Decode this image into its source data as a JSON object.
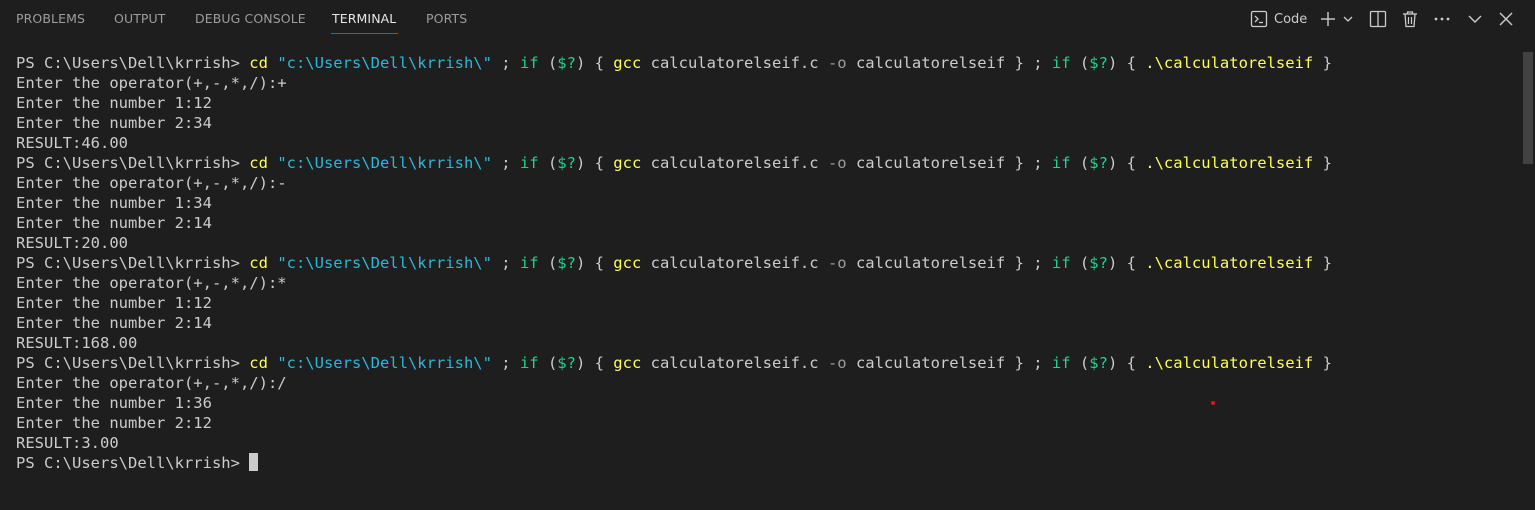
{
  "tabs": [
    {
      "label": "PROBLEMS",
      "active": false
    },
    {
      "label": "OUTPUT",
      "active": false
    },
    {
      "label": "DEBUG CONSOLE",
      "active": false
    },
    {
      "label": "TERMINAL",
      "active": true
    },
    {
      "label": "PORTS",
      "active": false
    }
  ],
  "toolbar": {
    "terminal_profile_label": "Code",
    "icons": [
      "terminal-icon",
      "plus-icon",
      "chevron-down-icon",
      "split-icon",
      "trash-icon",
      "more-icon",
      "chevron-down-icon",
      "close-icon"
    ]
  },
  "terminal": {
    "prompt": "PS C:\\Users\\Dell\\krrish> ",
    "command": {
      "cd": "cd",
      "path": "\"c:\\Users\\Dell\\krrish\\\"",
      "sep1": " ; ",
      "if1": "if",
      "cond1_open": " (",
      "cond1_var": "$?",
      "cond1_close": ") { ",
      "gcc": "gcc",
      "src": " calculatorelseif.c ",
      "flag": "-o",
      "out": " calculatorelseif } ; ",
      "if2": "if",
      "cond2_open": " (",
      "cond2_var": "$?",
      "cond2_close": ") { ",
      "exe": ".\\calculatorelseif",
      "end": " }"
    },
    "runs": [
      {
        "operator_line": "Enter the operator(+,-,*,/):+",
        "num1_line": "Enter the number 1:12",
        "num2_line": "Enter the number 2:34",
        "result_line": "RESULT:46.00"
      },
      {
        "operator_line": "Enter the operator(+,-,*,/):-",
        "num1_line": "Enter the number 1:34",
        "num2_line": "Enter the number 2:14",
        "result_line": "RESULT:20.00"
      },
      {
        "operator_line": "Enter the operator(+,-,*,/):*",
        "num1_line": "Enter the number 1:12",
        "num2_line": "Enter the number 2:14",
        "result_line": "RESULT:168.00"
      },
      {
        "operator_line": "Enter the operator(+,-,*,/):/",
        "num1_line": "Enter the number 1:36",
        "num2_line": "Enter the number 2:12",
        "result_line": "RESULT:3.00"
      }
    ],
    "final_prompt": "PS C:\\Users\\Dell\\krrish> "
  },
  "colors": {
    "background": "#1e1e1e",
    "text": "#cccccc",
    "command_yellow": "#ffff55",
    "string_cyan": "#29b8db",
    "keyword_green": "#23d18b",
    "flag_gray": "#9d9d9d",
    "active_tab_underline": "#0078d4"
  }
}
